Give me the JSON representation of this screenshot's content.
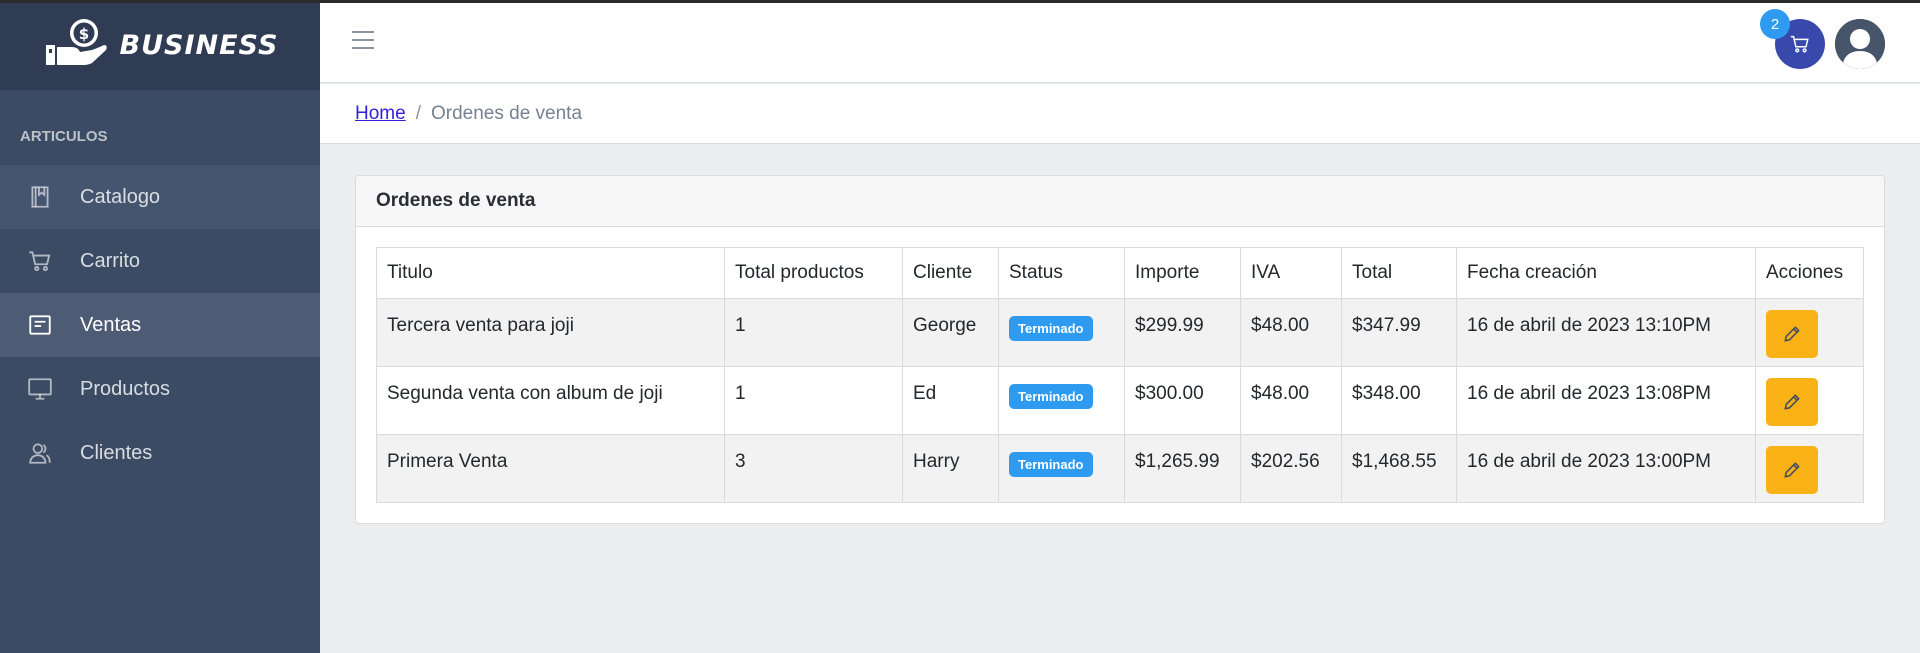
{
  "brand": {
    "name": "BUSINESS"
  },
  "sidebar": {
    "section_title": "ARTICULOS",
    "items": [
      {
        "label": "Catalogo",
        "icon": "book-icon"
      },
      {
        "label": "Carrito",
        "icon": "cart-icon"
      },
      {
        "label": "Ventas",
        "icon": "receipt-icon",
        "active": true
      },
      {
        "label": "Productos",
        "icon": "monitor-icon"
      },
      {
        "label": "Clientes",
        "icon": "people-icon"
      }
    ]
  },
  "header": {
    "cart_count": "2"
  },
  "breadcrumb": {
    "home": "Home",
    "separator": "/",
    "current": "Ordenes de venta"
  },
  "card": {
    "title": "Ordenes de venta"
  },
  "table": {
    "headers": [
      "Titulo",
      "Total productos",
      "Cliente",
      "Status",
      "Importe",
      "IVA",
      "Total",
      "Fecha creación",
      "Acciones"
    ],
    "rows": [
      {
        "titulo": "Tercera venta para joji",
        "total_productos": "1",
        "cliente": "George",
        "status": "Terminado",
        "importe": "$299.99",
        "iva": "$48.00",
        "total": "$347.99",
        "fecha": "16 de abril de 2023 13:10PM"
      },
      {
        "titulo": "Segunda venta con album de joji",
        "total_productos": "1",
        "cliente": "Ed",
        "status": "Terminado",
        "importe": "$300.00",
        "iva": "$48.00",
        "total": "$348.00",
        "fecha": "16 de abril de 2023 13:08PM"
      },
      {
        "titulo": "Primera Venta",
        "total_productos": "3",
        "cliente": "Harry",
        "status": "Terminado",
        "importe": "$1,265.99",
        "iva": "$202.56",
        "total": "$1,468.55",
        "fecha": "16 de abril de 2023 13:00PM"
      }
    ]
  },
  "colors": {
    "sidebar": "#3c4b64",
    "brand_bg": "#303c54",
    "active_item": "#4d5b75",
    "cart_button": "#3949ab",
    "badge_blue": "#2f9bf0",
    "edit_yellow": "#f9b115"
  }
}
